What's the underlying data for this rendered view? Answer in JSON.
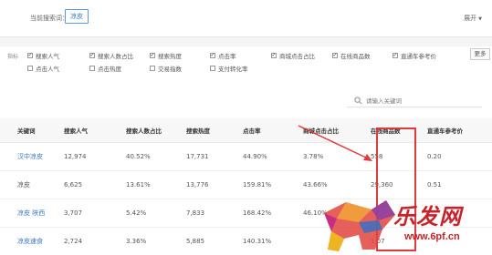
{
  "search_bar": {
    "current_label": "当前搜索词：",
    "current_keyword": "凉皮",
    "expand_label": "展开",
    "expand_caret": "▼"
  },
  "filters": {
    "label": "指标",
    "options": [
      {
        "label": "搜索人气",
        "checked": true
      },
      {
        "label": "搜索人数占比",
        "checked": true
      },
      {
        "label": "搜索热度",
        "checked": true
      },
      {
        "label": "点击率",
        "checked": true
      },
      {
        "label": "商城点击占比",
        "checked": true
      },
      {
        "label": "在线商品数",
        "checked": true
      },
      {
        "label": "直通车参考价",
        "checked": true
      },
      {
        "label": "点击人气",
        "checked": false
      },
      {
        "label": "点击热度",
        "checked": false
      },
      {
        "label": "交易指数",
        "checked": false
      },
      {
        "label": "支付转化率",
        "checked": false
      }
    ],
    "more_label": "更多"
  },
  "search": {
    "placeholder": "请输入关键词"
  },
  "table": {
    "columns": [
      "关键词",
      "搜索人气",
      "搜索人数占比",
      "搜索热度",
      "点击率",
      "商城点击占比",
      "在线商品数",
      "直通车参考价"
    ],
    "rows": [
      [
        "汉中凉皮",
        "12,974",
        "40.52%",
        "17,731",
        "44.90%",
        "3.78%",
        "558",
        "0.20"
      ],
      [
        "凉皮",
        "6,625",
        "13.61%",
        "13,776",
        "159.81%",
        "43.66%",
        "29,360",
        "0.51"
      ],
      [
        "凉皮 陕西",
        "3,707",
        "5.42%",
        "7,833",
        "168.42%",
        "46.10%",
        "",
        ""
      ],
      [
        "凉皮速食",
        "2,724",
        "3.36%",
        "5,885",
        "140.31%",
        "",
        "1,07",
        ""
      ]
    ]
  },
  "watermark": {
    "text": "乐发网",
    "url": "www.6pf.cn"
  },
  "colors": {
    "accent": "#3a78c2",
    "highlight": "#e23a3a",
    "watermark": "#c8232a"
  }
}
